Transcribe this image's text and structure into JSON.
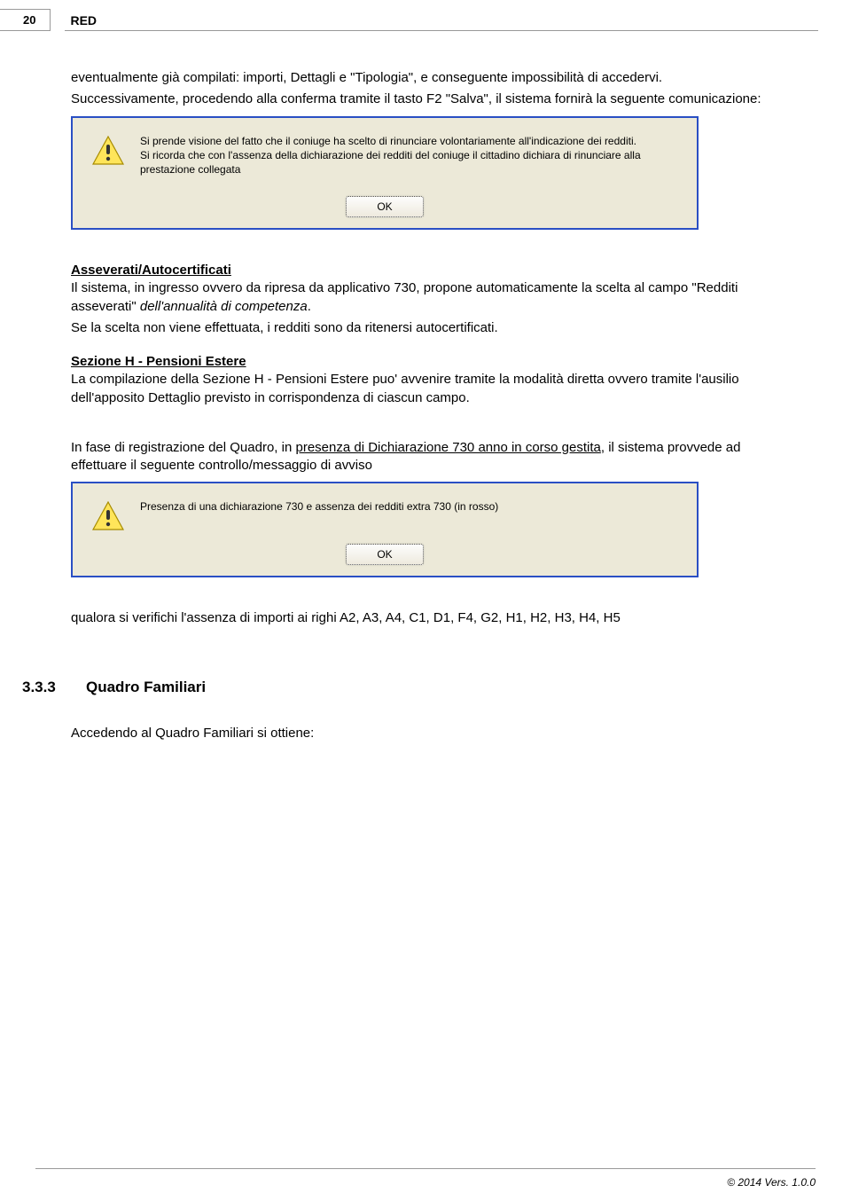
{
  "header": {
    "page_number": "20",
    "label": "RED"
  },
  "body": {
    "p1": "eventualmente già compilati: importi, Dettagli e \"Tipologia\", e conseguente impossibilità di accedervi.",
    "p2": "Successivamente, procedendo alla conferma tramite il tasto F2 \"Salva\", il sistema fornirà la seguente comunicazione:",
    "dialog1": {
      "l1": "Si prende visione del fatto che il coniuge ha scelto di rinunciare volontariamente all'indicazione dei redditi.",
      "l2": "Si ricorda che con l'assenza della dichiarazione dei redditi del coniuge il cittadino dichiara di rinunciare alla prestazione collegata",
      "ok": "OK"
    },
    "h_asseverati": "Asseverati/Autocertificati",
    "p3a": "Il sistema, in ingresso ovvero da ripresa da applicativo 730, propone automaticamente la scelta al campo \"Redditi asseverati\" ",
    "p3b_italic": "dell'annualità di competenza",
    "p3c": ".",
    "p4": "Se la scelta non viene effettuata, i redditi sono da ritenersi autocertificati.",
    "h_sezH": "Sezione H - Pensioni Estere",
    "p5": "La compilazione della Sezione H - Pensioni Estere puo' avvenire tramite la modalità diretta ovvero tramite l'ausilio dell'apposito Dettaglio previsto in corrispondenza di ciascun campo.",
    "p6a": "In fase di registrazione del Quadro, in ",
    "p6b_under": "presenza di Dichiarazione 730 anno in corso gestita",
    "p6c": ", il sistema provvede ad effettuare il seguente controllo/messaggio di avviso",
    "dialog2": {
      "text": "Presenza di una dichiarazione 730 e assenza dei redditi extra 730 (in rosso)",
      "ok": "OK"
    },
    "p7": "qualora si verifichi l'assenza di importi ai righi A2, A3, A4, C1, D1, F4, G2, H1, H2, H3, H4, H5"
  },
  "section": {
    "num": "3.3.3",
    "title": "Quadro Familiari",
    "p": "Accedendo al Quadro Familiari si ottiene:"
  },
  "footer": {
    "text": "© 2014 Vers. 1.0.0"
  }
}
